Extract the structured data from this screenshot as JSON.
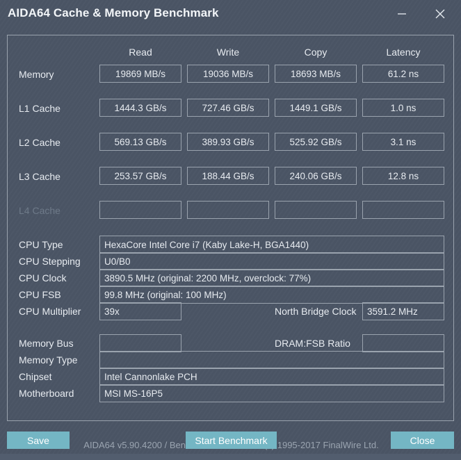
{
  "window": {
    "title": "AIDA64 Cache & Memory Benchmark",
    "minimize_icon": "minimize-icon",
    "close_icon": "close-icon"
  },
  "benchmark": {
    "columns": [
      "Read",
      "Write",
      "Copy",
      "Latency"
    ],
    "rows": [
      {
        "label": "Memory",
        "disabled": false,
        "values": [
          "19869 MB/s",
          "19036 MB/s",
          "18693 MB/s",
          "61.2 ns"
        ]
      },
      {
        "label": "L1 Cache",
        "disabled": false,
        "values": [
          "1444.3 GB/s",
          "727.46 GB/s",
          "1449.1 GB/s",
          "1.0 ns"
        ]
      },
      {
        "label": "L2 Cache",
        "disabled": false,
        "values": [
          "569.13 GB/s",
          "389.93 GB/s",
          "525.92 GB/s",
          "3.1 ns"
        ]
      },
      {
        "label": "L3 Cache",
        "disabled": false,
        "values": [
          "253.57 GB/s",
          "188.44 GB/s",
          "240.06 GB/s",
          "12.8 ns"
        ]
      },
      {
        "label": "L4 Cache",
        "disabled": true,
        "values": [
          "",
          "",
          "",
          ""
        ]
      }
    ]
  },
  "cpu_info": {
    "type_label": "CPU Type",
    "type_value": "HexaCore Intel Core i7  (Kaby Lake-H, BGA1440)",
    "stepping_label": "CPU Stepping",
    "stepping_value": "U0/B0",
    "clock_label": "CPU Clock",
    "clock_value": "3890.5 MHz  (original: 2200 MHz, overclock: 77%)",
    "fsb_label": "CPU FSB",
    "fsb_value": "99.8 MHz  (original: 100 MHz)",
    "multiplier_label": "CPU Multiplier",
    "multiplier_value": "39x",
    "north_bridge_label": "North Bridge Clock",
    "north_bridge_value": "3591.2 MHz"
  },
  "memory_info": {
    "bus_label": "Memory Bus",
    "bus_value": "",
    "dram_fsb_label": "DRAM:FSB Ratio",
    "dram_fsb_value": "",
    "type_label": "Memory Type",
    "type_value": "",
    "chipset_label": "Chipset",
    "chipset_value": "Intel Cannonlake PCH",
    "motherboard_label": "Motherboard",
    "motherboard_value": "MSI MS-16P5"
  },
  "footer": {
    "version_text": "AIDA64 v5.90.4200 / BenchDLL 4.3.741-x64  (c) 1995-2017 FinalWire Ltd."
  },
  "buttons": {
    "save": "Save",
    "start_benchmark": "Start Benchmark",
    "close": "Close"
  },
  "colors": {
    "background": "#4b5565",
    "accent_button": "#74b6c4",
    "border": "#9aa3ae",
    "text": "#e7ebf0",
    "text_dim": "#6e7a89"
  }
}
